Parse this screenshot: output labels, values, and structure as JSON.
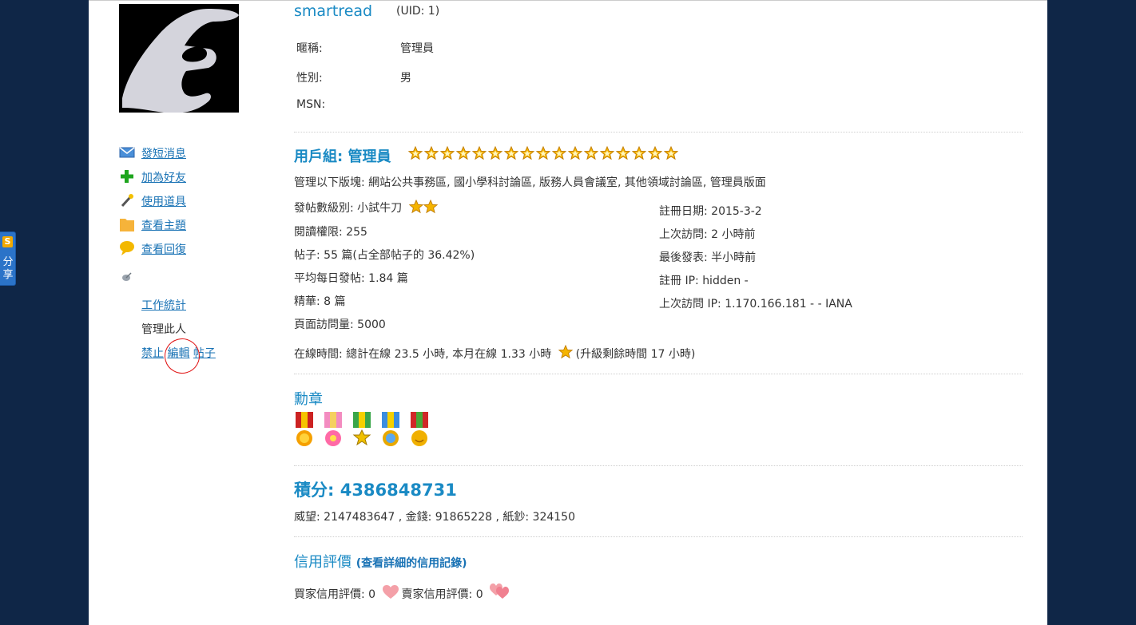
{
  "profile": {
    "username": "smartread",
    "uid": "(UID: 1)",
    "fields": [
      {
        "label": "暱稱:",
        "value": "管理員"
      },
      {
        "label": "性別:",
        "value": "男"
      },
      {
        "label": "MSN:",
        "value": ""
      }
    ]
  },
  "share": {
    "label": "分享",
    "logo": "S"
  },
  "left_menu": {
    "send_message": "發短消息",
    "add_friend": "加為好友",
    "use_tool": "使用道具",
    "view_topics": "查看主題",
    "view_replies": "查看回復",
    "work_stats": "工作統計",
    "manage_user": "管理此人",
    "ban": "禁止",
    "edit": "編輯",
    "posts": "帖子"
  },
  "group": {
    "title": "用戶組: 管理員",
    "star_count": 17,
    "manages": "管理以下版塊: 網站公共事務區, 國小學科討論區, 版務人員會議室, 其他領域討論區, 管理員版面"
  },
  "stats_left": [
    "發帖數級別: 小試牛刀",
    "閱讀權限: 255",
    "帖子: 55 篇(占全部帖子的 36.42%)",
    "平均每日發帖: 1.84 篇",
    "精華: 8 篇",
    "頁面訪問量: 5000"
  ],
  "stats_right": [
    "註冊日期: 2015-3-2",
    "上次訪問: 2 小時前",
    "最後發表: 半小時前",
    "註冊 IP: hidden -",
    "上次訪問 IP: 1.170.166.181 - - IANA"
  ],
  "online": {
    "main": "在線時間: 總計在線 23.5 小時, 本月在線 1.33 小時",
    "upgrade": "(升級剩餘時間 17 小時)"
  },
  "medals": {
    "title": "勳章",
    "count": 5
  },
  "points": {
    "title": "積分: 4386848731",
    "detail": "威望: 2147483647 , 金錢: 91865228 , 紙鈔: 324150"
  },
  "credit": {
    "title": "信用評價",
    "link": "(查看詳細的信用記錄)",
    "buyer": "買家信用評價: 0",
    "seller": "賣家信用評價: 0"
  },
  "colors": {
    "background": "#0f2647",
    "link": "#1a73b5",
    "title": "#1a8ac4",
    "star": "#f5b400"
  }
}
